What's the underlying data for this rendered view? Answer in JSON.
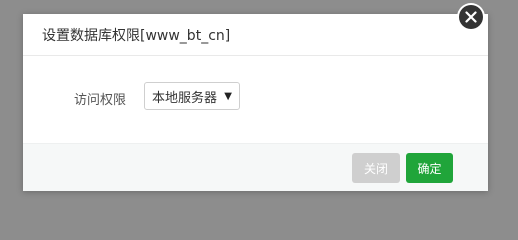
{
  "dialog": {
    "title": "设置数据库权限[www_bt_cn]",
    "field_label": "访问权限",
    "select_value": "本地服务器",
    "close_label": "关闭",
    "confirm_label": "确定"
  },
  "colors": {
    "overlay": "#8d8d8d",
    "confirm": "#20a53a",
    "close_button": "#cfcfcf",
    "footer": "#f6f8f8"
  }
}
